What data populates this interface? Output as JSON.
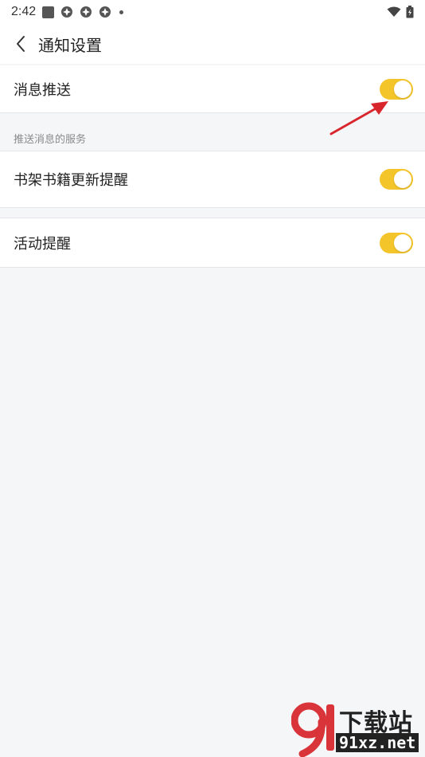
{
  "status_bar": {
    "time": "2:42"
  },
  "header": {
    "title": "通知设置"
  },
  "rows": {
    "message_push": {
      "label": "消息推送",
      "enabled": true
    },
    "bookshelf_update": {
      "label": "书架书籍更新提醒",
      "enabled": true
    },
    "activity_reminder": {
      "label": "活动提醒",
      "enabled": true
    }
  },
  "section": {
    "title": "推送消息的服务"
  },
  "watermark": {
    "brand": "下载站",
    "url": "91xz.net",
    "logo": "91"
  },
  "colors": {
    "toggle_on": "#f4c52b",
    "annotation_arrow": "#d8262d",
    "background": "#f5f6f8"
  },
  "icons": {
    "back": "chevron-left-icon",
    "wifi": "wifi-icon",
    "battery": "battery-icon"
  }
}
